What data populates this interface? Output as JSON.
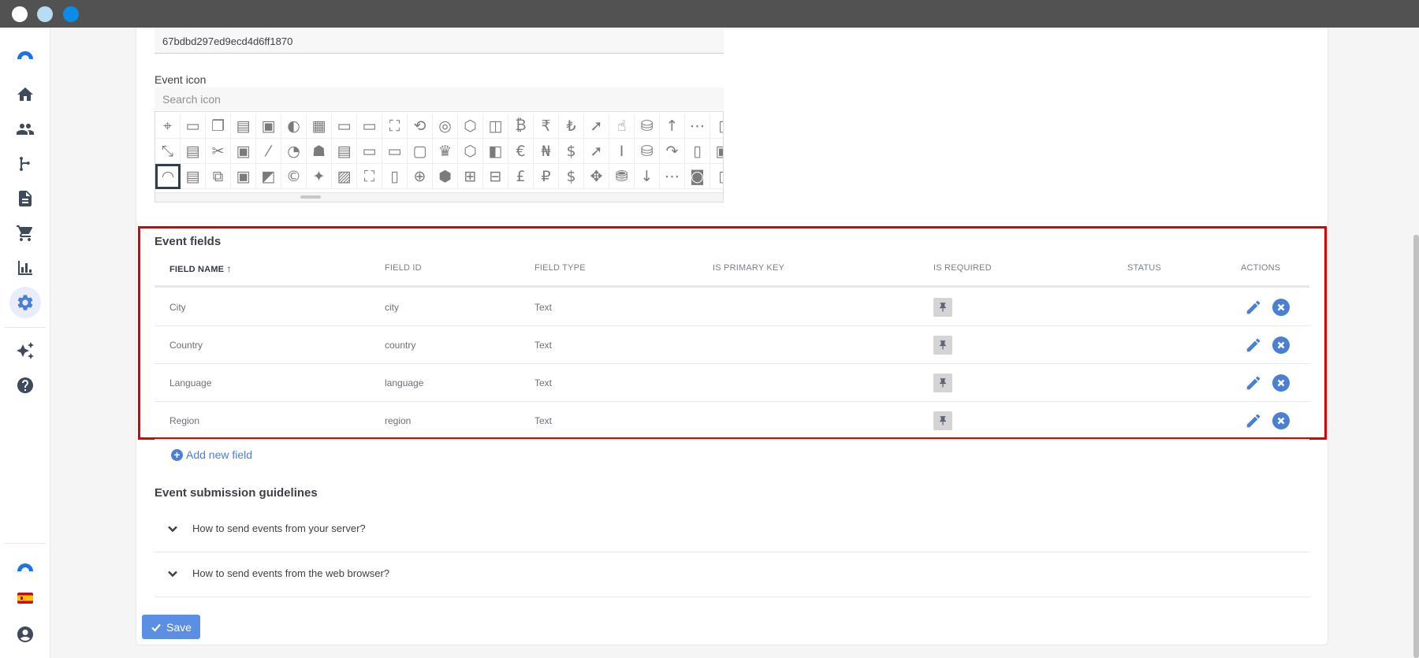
{
  "window": {
    "traffic_lights": [
      {
        "name": "close",
        "color": "#ffffff"
      },
      {
        "name": "minimize",
        "color": "#b9dcf5"
      },
      {
        "name": "maximize",
        "color": "#0c8ce9"
      }
    ]
  },
  "sidebar": {
    "items": [
      {
        "name": "logo-icon"
      },
      {
        "name": "home-icon"
      },
      {
        "name": "users-icon"
      },
      {
        "name": "flow-icon"
      },
      {
        "name": "document-icon"
      },
      {
        "name": "cart-icon"
      },
      {
        "name": "bar-chart-icon"
      },
      {
        "name": "settings-icon",
        "active": true
      },
      {
        "name": "sparkles-icon"
      },
      {
        "name": "help-icon"
      }
    ],
    "bottom": [
      {
        "name": "app-logo-icon"
      },
      {
        "name": "spain-flag-icon"
      },
      {
        "name": "account-icon"
      }
    ]
  },
  "form": {
    "event_id_value": "67bdbd297ed9ecd4d6ff1870",
    "event_icon_label": "Event icon",
    "search_icon_placeholder": "Search icon"
  },
  "event_fields": {
    "title": "Event fields",
    "columns": {
      "field_name": "FIELD NAME",
      "field_id": "FIELD ID",
      "field_type": "FIELD TYPE",
      "is_primary_key": "IS PRIMARY KEY",
      "is_required": "IS REQUIRED",
      "status": "STATUS",
      "actions": "ACTIONS"
    },
    "sort_indicator": "↑",
    "rows": [
      {
        "name": "City",
        "id": "city",
        "type": "Text"
      },
      {
        "name": "Country",
        "id": "country",
        "type": "Text"
      },
      {
        "name": "Language",
        "id": "language",
        "type": "Text"
      },
      {
        "name": "Region",
        "id": "region",
        "type": "Text"
      }
    ],
    "add_new_label": "Add new field"
  },
  "guidelines": {
    "title": "Event submission guidelines",
    "items": [
      {
        "label": "How to send events from your server?"
      },
      {
        "label": "How to send events from the web browser?"
      }
    ]
  },
  "actions": {
    "save_label": "Save"
  },
  "colors": {
    "accent": "#4a7fd4",
    "highlight_border": "#e00000",
    "titlebar": "#525252"
  }
}
